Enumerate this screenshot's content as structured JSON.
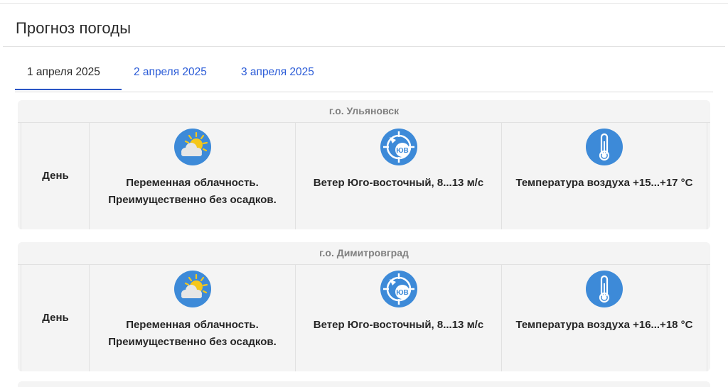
{
  "panel": {
    "title": "Прогноз погоды"
  },
  "tabs": [
    {
      "label": "1 апреля 2025",
      "active": true
    },
    {
      "label": "2 апреля 2025",
      "active": false
    },
    {
      "label": "3 апреля 2025",
      "active": false
    }
  ],
  "cities": [
    {
      "name": "г.о. Ульяновск",
      "period": "День",
      "sky": "Переменная облачность. Преимущественно без осадков.",
      "wind": {
        "badge": "ЮВ",
        "text": "Ветер Юго-восточный, 8...13 м/с"
      },
      "temp": "Температура воздуха +15...+17 °С"
    },
    {
      "name": "г.о. Димитровград",
      "period": "День",
      "sky": "Переменная облачность. Преимущественно без осадков.",
      "wind": {
        "badge": "ЮВ",
        "text": "Ветер Юго-восточный, 8...13 м/с"
      },
      "temp": "Температура воздуха +16...+18 °С"
    }
  ],
  "icons": {
    "sky": "partly-cloudy-icon",
    "wind": "wind-direction-icon",
    "temp": "thermometer-icon"
  },
  "colors": {
    "accent": "#2b56c5",
    "link": "#2a5bd7",
    "icon_blue": "#3d8ad8",
    "sun": "#f5c71a",
    "card_bg": "#f4f4f4"
  }
}
